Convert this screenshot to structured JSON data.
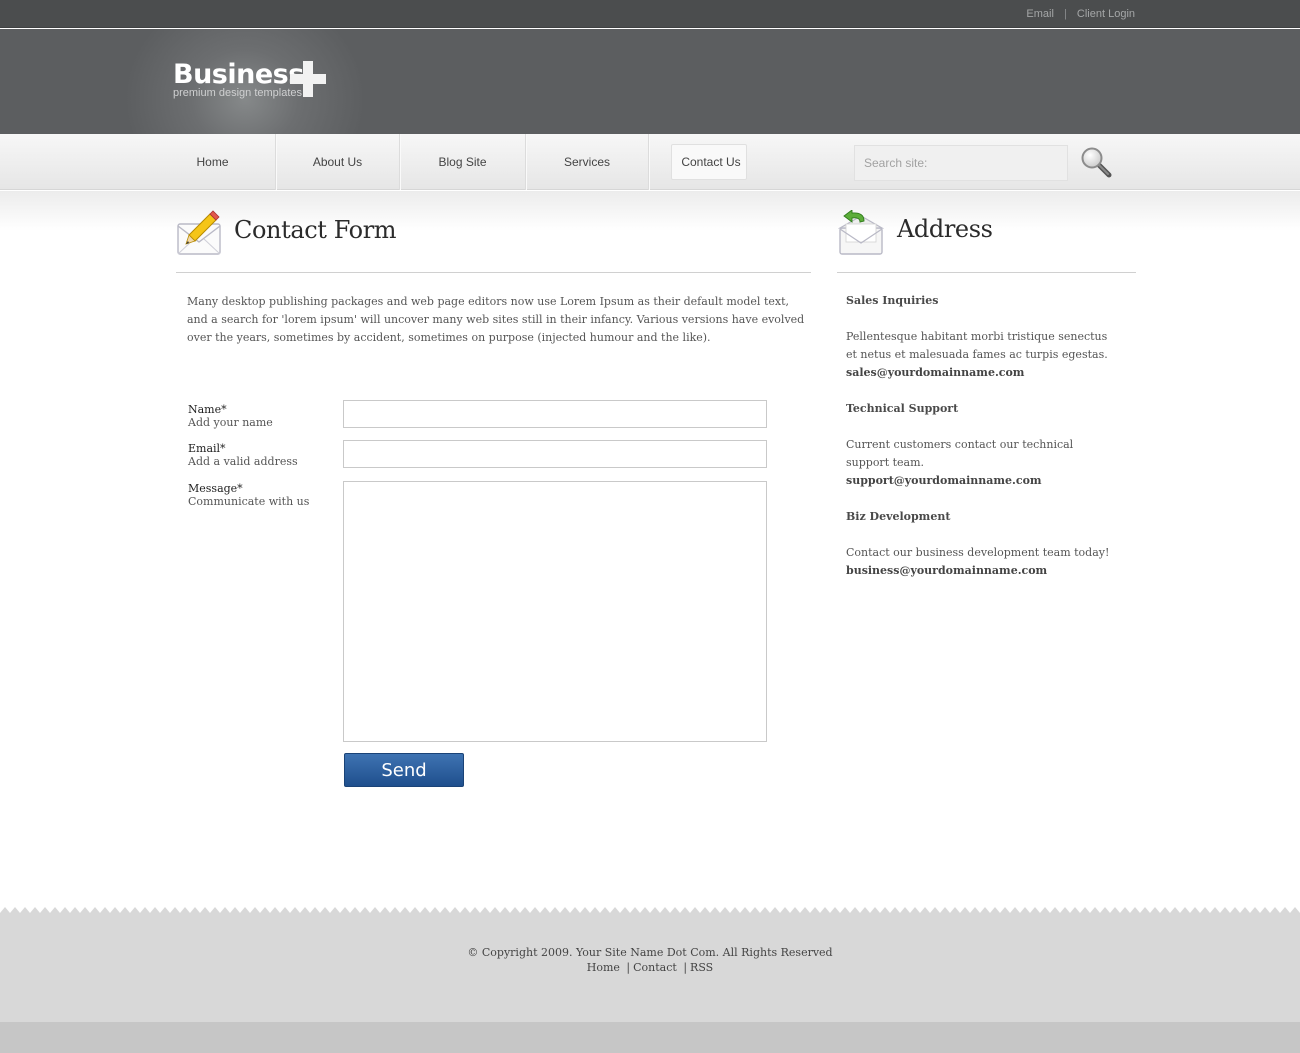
{
  "topbar": {
    "links": [
      "Email",
      "Client Login"
    ],
    "separator": "|"
  },
  "logo": {
    "brand": "Business",
    "tagline": "premium design templates"
  },
  "nav": {
    "items": [
      "Home",
      "About Us",
      "Blog Site",
      "Services",
      "Contact Us"
    ],
    "active": "Contact Us"
  },
  "search": {
    "placeholder": "Search site:",
    "icon": "magnifier-icon"
  },
  "contact": {
    "title": "Contact Form",
    "icon": "pencil-envelope-icon",
    "intro": "Many desktop publishing packages and web page editors now use Lorem Ipsum as their default model text, and a search for 'lorem ipsum' will uncover many web sites still in their infancy. Various versions have evolved over the years, sometimes by accident, sometimes on purpose (injected humour and the like).",
    "fields": [
      {
        "label": "Name*",
        "hint": "Add your name",
        "value": ""
      },
      {
        "label": "Email*",
        "hint": "Add a valid address",
        "value": ""
      },
      {
        "label": "Message*",
        "hint": "Communicate with us",
        "value": ""
      }
    ],
    "send_label": "Send",
    "send_color": "#2a5d9f"
  },
  "address": {
    "title": "Address",
    "icon": "reply-envelope-icon",
    "blocks": [
      {
        "title": "Sales Inquiries",
        "text": "Pellentesque habitant morbi tristique senectus et netus et malesuada fames ac turpis egestas.",
        "email": "sales@yourdomainname.com"
      },
      {
        "title": "Technical Support",
        "text": "Current customers contact our technical support team.",
        "email": "support@yourdomainname.com"
      },
      {
        "title": "Biz Development",
        "text": "Contact our business development team today!",
        "email": "business@yourdomainname.com"
      }
    ]
  },
  "footer": {
    "copyright": "© Copyright 2009. Your Site Name Dot Com. All Rights Reserved",
    "links": [
      "Home",
      "Contact",
      "RSS"
    ],
    "separator": "|"
  }
}
